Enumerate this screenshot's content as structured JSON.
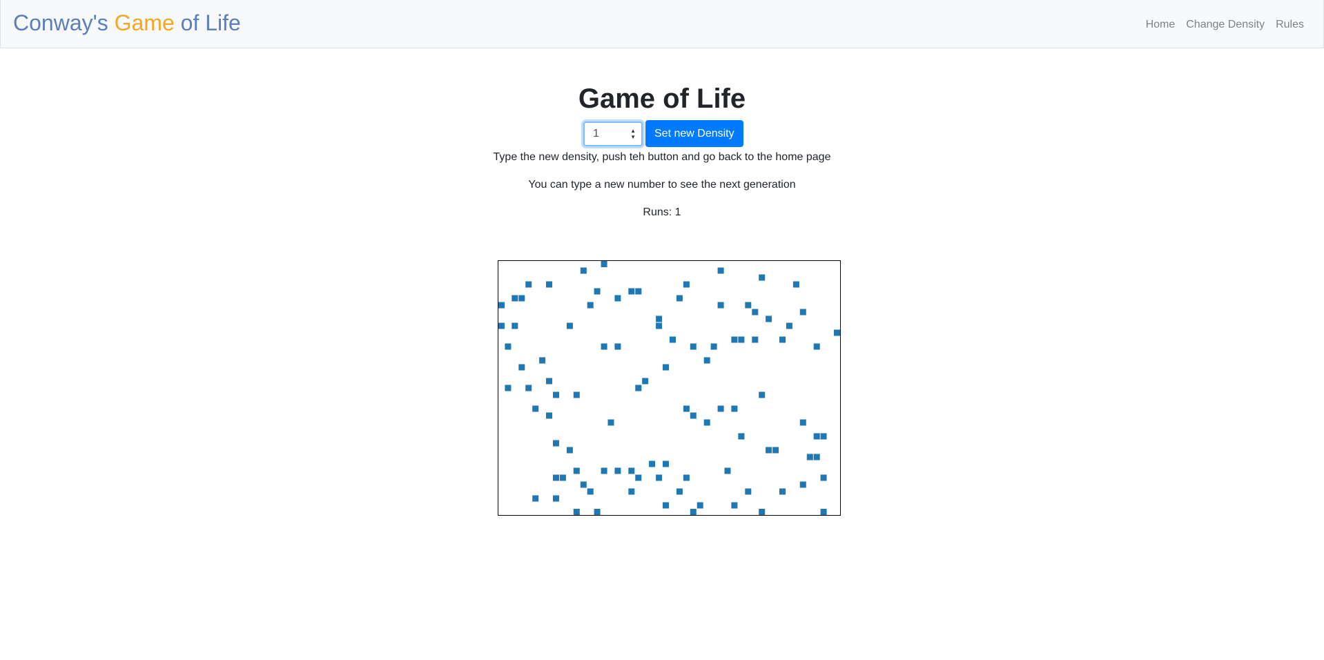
{
  "brand": {
    "part1": "Conway's ",
    "part2": "Game",
    "part3": " of Life"
  },
  "nav": {
    "home": "Home",
    "change_density": "Change Density",
    "rules": "Rules"
  },
  "main": {
    "title": "Game of Life",
    "density_input_value": "1",
    "set_density_button": "Set new Density",
    "instruction": "Type the new density, push teh button and go back to the home page",
    "hint": "You can type a new number to see the next generation",
    "runs_label": "Runs: 1"
  },
  "colors": {
    "cell": "#1f77b4",
    "accent": "#007bff",
    "brand_blue": "#5a7fbd",
    "brand_orange": "#f5a623"
  },
  "board": {
    "columns": 50,
    "rows": 37,
    "live_cells": [
      [
        15,
        0
      ],
      [
        4,
        3
      ],
      [
        7,
        3
      ],
      [
        27,
        3
      ],
      [
        20,
        4
      ],
      [
        12,
        1
      ],
      [
        14,
        4
      ],
      [
        19,
        4
      ],
      [
        2,
        5
      ],
      [
        3,
        5
      ],
      [
        0,
        6
      ],
      [
        13,
        6
      ],
      [
        17,
        5
      ],
      [
        26,
        5
      ],
      [
        32,
        1
      ],
      [
        38,
        2
      ],
      [
        43,
        3
      ],
      [
        32,
        6
      ],
      [
        36,
        6
      ],
      [
        37,
        7
      ],
      [
        39,
        8
      ],
      [
        44,
        7
      ],
      [
        42,
        9
      ],
      [
        46,
        12
      ],
      [
        49,
        10
      ],
      [
        23,
        8
      ],
      [
        23,
        9
      ],
      [
        10,
        9
      ],
      [
        2,
        9
      ],
      [
        0,
        9
      ],
      [
        1,
        12
      ],
      [
        3,
        15
      ],
      [
        6,
        14
      ],
      [
        17,
        12
      ],
      [
        15,
        12
      ],
      [
        25,
        11
      ],
      [
        28,
        12
      ],
      [
        31,
        12
      ],
      [
        34,
        11
      ],
      [
        35,
        11
      ],
      [
        37,
        11
      ],
      [
        41,
        11
      ],
      [
        24,
        15
      ],
      [
        30,
        14
      ],
      [
        20,
        18
      ],
      [
        21,
        17
      ],
      [
        11,
        19
      ],
      [
        4,
        18
      ],
      [
        7,
        17
      ],
      [
        8,
        19
      ],
      [
        1,
        18
      ],
      [
        5,
        21
      ],
      [
        7,
        22
      ],
      [
        16,
        23
      ],
      [
        27,
        21
      ],
      [
        28,
        22
      ],
      [
        32,
        21
      ],
      [
        30,
        23
      ],
      [
        34,
        21
      ],
      [
        38,
        19
      ],
      [
        44,
        23
      ],
      [
        46,
        25
      ],
      [
        47,
        25
      ],
      [
        8,
        26
      ],
      [
        10,
        27
      ],
      [
        35,
        25
      ],
      [
        40,
        27
      ],
      [
        39,
        27
      ],
      [
        46,
        28
      ],
      [
        45,
        28
      ],
      [
        8,
        31
      ],
      [
        9,
        31
      ],
      [
        11,
        30
      ],
      [
        15,
        30
      ],
      [
        17,
        30
      ],
      [
        19,
        30
      ],
      [
        22,
        29
      ],
      [
        24,
        29
      ],
      [
        27,
        31
      ],
      [
        33,
        30
      ],
      [
        23,
        31
      ],
      [
        20,
        31
      ],
      [
        12,
        32
      ],
      [
        13,
        33
      ],
      [
        19,
        33
      ],
      [
        36,
        33
      ],
      [
        26,
        33
      ],
      [
        41,
        33
      ],
      [
        44,
        32
      ],
      [
        47,
        31
      ],
      [
        5,
        34
      ],
      [
        8,
        34
      ],
      [
        24,
        35
      ],
      [
        29,
        35
      ],
      [
        11,
        36
      ],
      [
        14,
        36
      ],
      [
        28,
        36
      ],
      [
        34,
        35
      ],
      [
        38,
        36
      ],
      [
        47,
        36
      ]
    ]
  }
}
